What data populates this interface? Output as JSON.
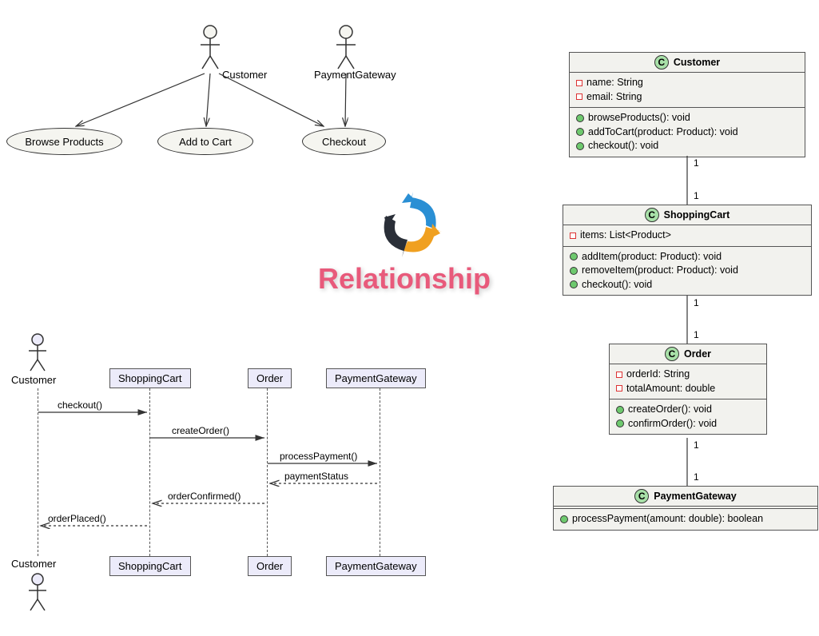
{
  "centerTitle": "Relationship",
  "useCase": {
    "actors": {
      "customer": {
        "label": "Customer"
      },
      "paymentGateway": {
        "label": "PaymentGateway"
      }
    },
    "cases": {
      "browse": "Browse Products",
      "addToCart": "Add to Cart",
      "checkout": "Checkout"
    }
  },
  "sequence": {
    "participants": {
      "customer": "Customer",
      "shoppingCart": "ShoppingCart",
      "order": "Order",
      "paymentGateway": "PaymentGateway"
    },
    "messages": {
      "m1": "checkout()",
      "m2": "createOrder()",
      "m3": "processPayment()",
      "m4": "paymentStatus",
      "m5": "orderConfirmed()",
      "m6": "orderPlaced()"
    }
  },
  "classes": {
    "customer": {
      "name": "Customer",
      "attrs": [
        "name: String",
        "email: String"
      ],
      "ops": [
        "browseProducts(): void",
        "addToCart(product: Product): void",
        "checkout(): void"
      ]
    },
    "shoppingCart": {
      "name": "ShoppingCart",
      "attrs": [
        "items: List<Product>"
      ],
      "ops": [
        "addItem(product: Product): void",
        "removeItem(product: Product): void",
        "checkout(): void"
      ]
    },
    "order": {
      "name": "Order",
      "attrs": [
        "orderId: String",
        "totalAmount: double"
      ],
      "ops": [
        "createOrder(): void",
        "confirmOrder(): void"
      ]
    },
    "paymentGateway": {
      "name": "PaymentGateway",
      "attrs": [],
      "ops": [
        "processPayment(amount: double): boolean"
      ]
    },
    "multiplicity": "1"
  }
}
